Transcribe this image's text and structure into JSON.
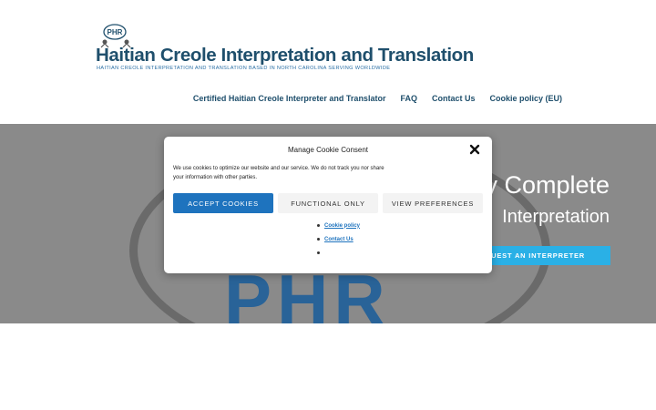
{
  "header": {
    "logo_text": "PHR",
    "site_title": "Haitian Creole Interpretation and Translation",
    "tagline": "HAITIAN CREOLE INTERPRETATION AND TRANSLATION BASED IN NORTH CAROLINA SERVING WORLDWIDE"
  },
  "nav": {
    "items": [
      {
        "label": "Certified Haitian Creole Interpreter and Translator"
      },
      {
        "label": "FAQ"
      },
      {
        "label": "Contact Us"
      },
      {
        "label": "Cookie policy (EU)"
      }
    ]
  },
  "hero": {
    "title_fragment": "y Complete",
    "subtitle_fragment": "Interpretation",
    "cta_fragment": "EQUEST AN INTERPRETER",
    "logo_text": "PHR"
  },
  "cookie_modal": {
    "title": "Manage Cookie Consent",
    "text": "We use cookies to optimize our website and our service. We do not track you nor share your information with other parties.",
    "accept_label": "ACCEPT COOKIES",
    "functional_label": "FUNCTIONAL ONLY",
    "preferences_label": "VIEW PREFERENCES",
    "links": [
      {
        "label": "Cookie policy"
      },
      {
        "label": "Contact Us"
      },
      {
        "label": ""
      }
    ]
  },
  "colors": {
    "title": "#1f4f6c",
    "accent": "#1e73be",
    "cta": "#2ab0e6",
    "hero_bg": "#8a8a8a"
  },
  "icons": {
    "logo": "phr-logo-icon",
    "close": "close-icon"
  }
}
